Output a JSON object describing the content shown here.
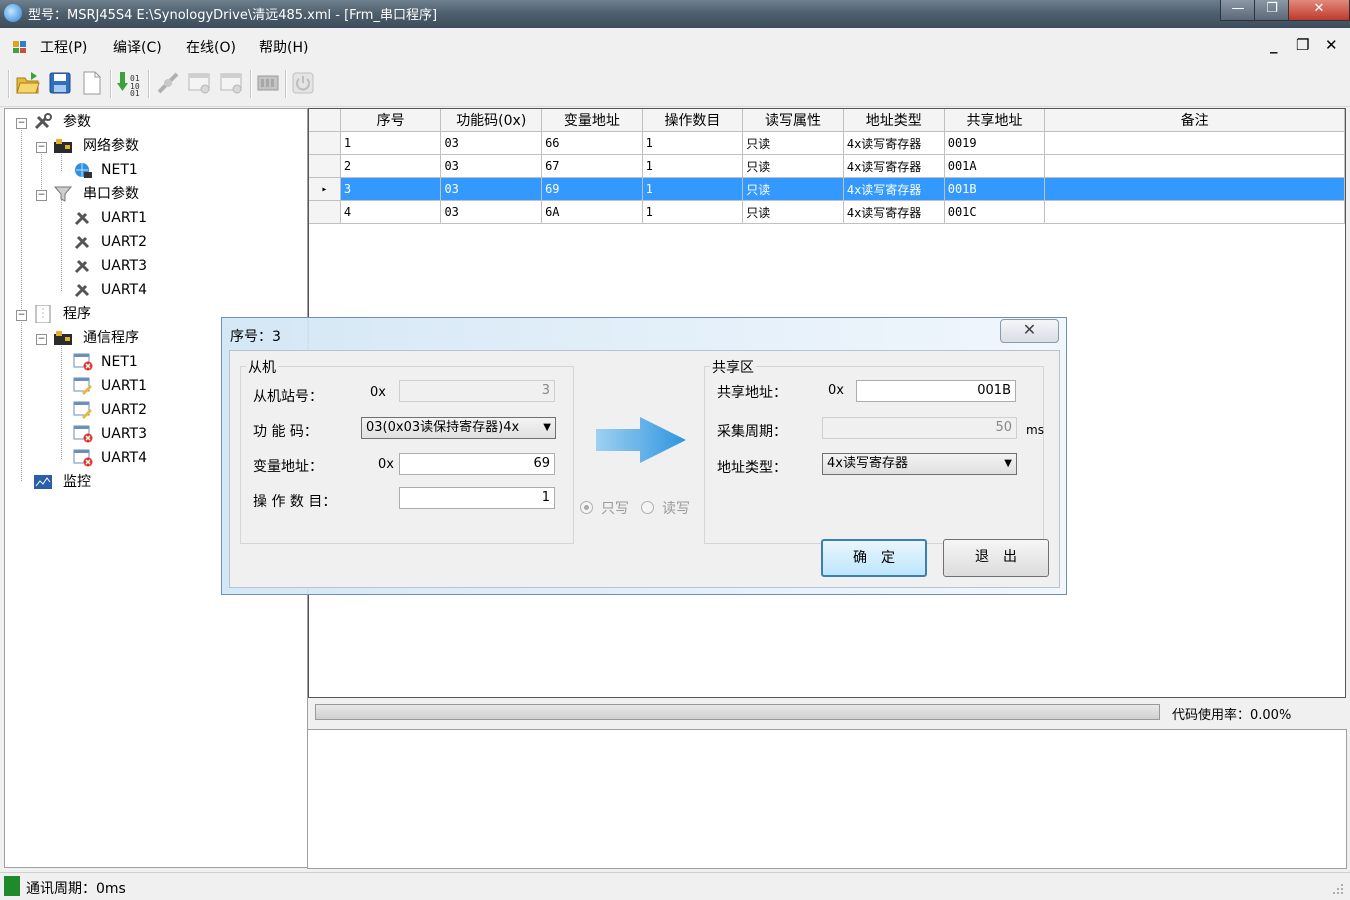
{
  "window": {
    "title": "型号：MSRJ45S4   E:\\SynologyDrive\\清远485.xml - [Frm_串口程序]",
    "min": "—",
    "max": "❐",
    "close": "✕"
  },
  "menu": {
    "items": [
      "工程(P)",
      "编译(C)",
      "在线(O)",
      "帮助(H)"
    ],
    "mdi_min": "_",
    "mdi_restore": "❐",
    "mdi_close": "✕"
  },
  "tree": {
    "params": "参数",
    "net_params": "网络参数",
    "net1": "NET1",
    "serial_params": "串口参数",
    "uart1": "UART1",
    "uart2": "UART2",
    "uart3": "UART3",
    "uart4": "UART4",
    "program": "程序",
    "comm_program": "通信程序",
    "p_net1": "NET1",
    "p_uart1": "UART1",
    "p_uart2": "UART2",
    "p_uart3": "UART3",
    "p_uart4": "UART4",
    "monitor": "监控"
  },
  "grid": {
    "headers": [
      "序号",
      "功能码(0x)",
      "变量地址",
      "操作数目",
      "读写属性",
      "地址类型",
      "共享地址",
      "备注"
    ],
    "rows": [
      [
        "1",
        "03",
        "66",
        "1",
        "只读",
        "4x读写寄存器",
        "0019",
        ""
      ],
      [
        "2",
        "03",
        "67",
        "1",
        "只读",
        "4x读写寄存器",
        "001A",
        ""
      ],
      [
        "3",
        "03",
        "69",
        "1",
        "只读",
        "4x读写寄存器",
        "001B",
        ""
      ],
      [
        "4",
        "03",
        "6A",
        "1",
        "只读",
        "4x读写寄存器",
        "001C",
        ""
      ]
    ],
    "selected_row": 2,
    "row_marker": "▸"
  },
  "code_usage": "代码使用率：0.00%",
  "status": "通讯周期：0ms",
  "dialog": {
    "title": "序号：3",
    "close": "✕",
    "slave_group": "从机",
    "slave_station_label": "从机站号：",
    "slave_station_prefix": "0x",
    "slave_station_value": "3",
    "function_code_label": "功 能 码：",
    "function_code_value": "03(0x03读保持寄存器)4x",
    "var_addr_label": "变量地址：",
    "var_addr_prefix": "0x",
    "var_addr_value": "69",
    "op_count_label": "操 作 数 目：",
    "op_count_value": "1",
    "radio_write_only": "只写",
    "radio_read_write": "读写",
    "share_group": "共享区",
    "share_addr_label": "共享地址：",
    "share_addr_prefix": "0x",
    "share_addr_value": "001B",
    "period_label": "采集周期：",
    "period_value": "50",
    "period_unit": "ms",
    "addr_type_label": "地址类型：",
    "addr_type_value": "4x读写寄存器",
    "ok": "确　定",
    "exit": "退　出"
  }
}
